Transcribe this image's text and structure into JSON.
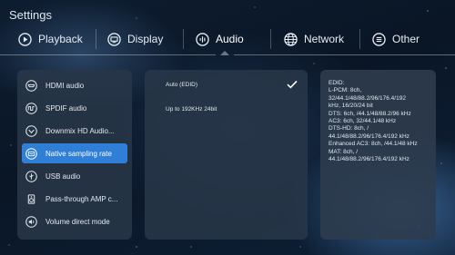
{
  "header": {
    "title": "Settings"
  },
  "tabs": [
    {
      "label": "Playback",
      "icon": "play-circle-icon"
    },
    {
      "label": "Display",
      "icon": "display-icon"
    },
    {
      "label": "Audio",
      "icon": "audio-icon",
      "active": true
    },
    {
      "label": "Network",
      "icon": "globe-icon"
    },
    {
      "label": "Other",
      "icon": "menu-circle-icon"
    }
  ],
  "menu": {
    "items": [
      {
        "label": "HDMI audio",
        "icon": "hdmi-icon"
      },
      {
        "label": "SPDIF audio",
        "icon": "spdif-icon"
      },
      {
        "label": "Downmix HD Audio...",
        "icon": "downmix-icon"
      },
      {
        "label": "Native sampling rate",
        "icon": "sampling-rate-icon",
        "selected": true
      },
      {
        "label": "USB audio",
        "icon": "usb-icon"
      },
      {
        "label": "Pass-through AMP c...",
        "icon": "amp-icon"
      },
      {
        "label": "Volume direct mode",
        "icon": "volume-icon"
      }
    ]
  },
  "options": {
    "items": [
      {
        "label": "Auto (EDID)",
        "checked": true
      },
      {
        "label": "Up to 192KHz 24bit",
        "checked": false
      }
    ]
  },
  "info": {
    "lines": [
      "EDID:",
      "L-PCM: 8ch,",
      "32/44.1/48/88.2/96/176.4/192",
      "kHz, 16/20/24 bit",
      "DTS: 6ch, /44.1/48/88.2/96 kHz",
      "AC3: 6ch, 32/44.1/48 kHz",
      "DTS-HD: 8ch, /",
      "44.1/48/88.2/96/176.4/192 kHz",
      "Enhanced AC3: 8ch, /44.1/48 kHz",
      "MAT: 8ch, /",
      "44.1/48/88.2/96/176.4/192 kHz"
    ]
  },
  "colors": {
    "accent": "#2f7fd6",
    "panel": "#28374a"
  }
}
